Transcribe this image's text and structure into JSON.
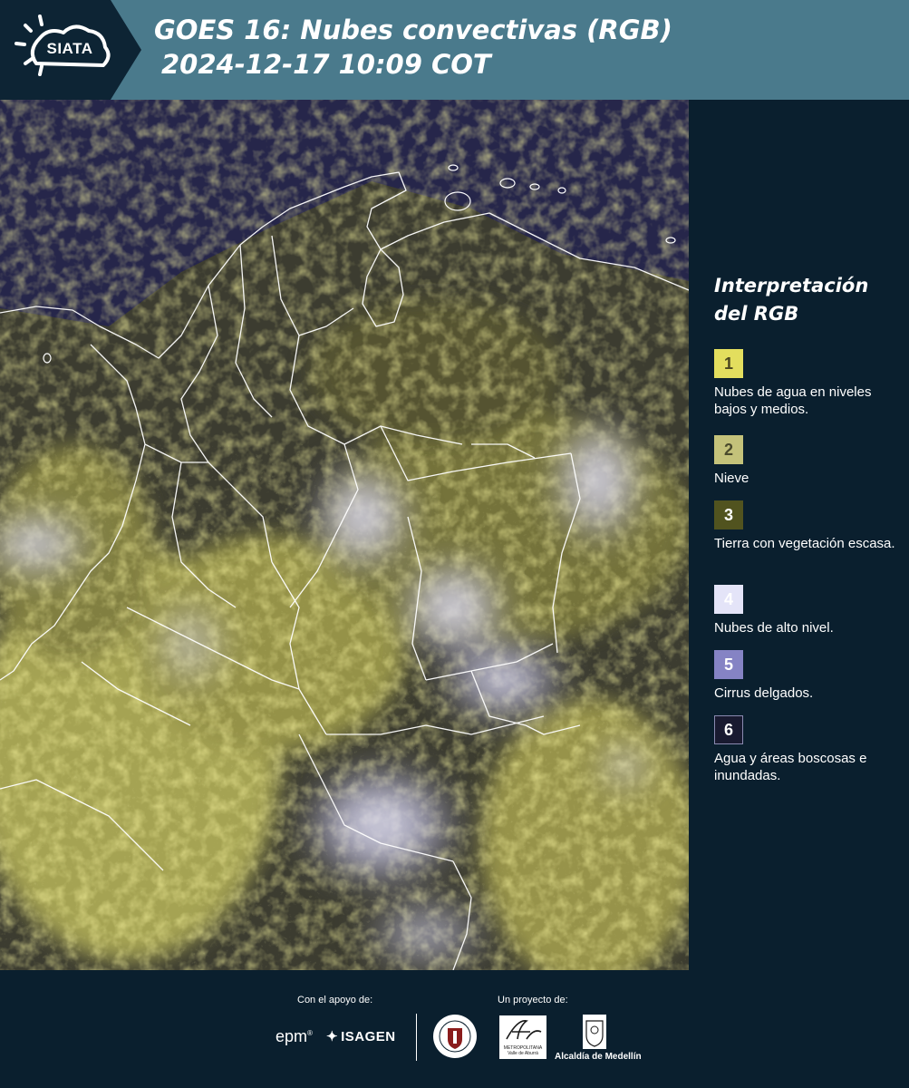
{
  "header": {
    "logo_text": "SIATA",
    "title": "GOES 16: Nubes convectivas (RGB)",
    "subtitle": "2024-12-17 10:09 COT"
  },
  "legend": {
    "title": "Interpretación del RGB",
    "items": [
      {
        "number": "1",
        "label": "Nubes de agua en niveles bajos y medios.",
        "color": "#e3de5e",
        "text_color": "#4a4620"
      },
      {
        "number": "2",
        "label": "Nieve",
        "color": "#c4c27a",
        "text_color": "#4a4a2c"
      },
      {
        "number": "3",
        "label": "Tierra con vegetación escasa.",
        "color": "#51531f",
        "text_color": "#ffffff"
      },
      {
        "number": "4",
        "label": "Nubes de alto nivel.",
        "color": "#e4e4f8",
        "text_color": "#ffffff"
      },
      {
        "number": "5",
        "label": "Cirrus delgados.",
        "color": "#8583c4",
        "text_color": "#ffffff"
      },
      {
        "number": "6",
        "label": "Agua y áreas boscosas e inundadas.",
        "color": "#191a30",
        "text_color": "#ffffff"
      }
    ]
  },
  "footer": {
    "support_label": "Con el apoyo de:",
    "project_label": "Un proyecto de:",
    "sponsors": [
      "epm",
      "ISAGEN"
    ],
    "partners": [
      "Área Metropolitana",
      "Alcaldía de Medellín"
    ],
    "area_caption": "METROPOLITANA Valle de Aburrá",
    "alcaldia_label": "Alcaldía de Medellín"
  },
  "colors": {
    "header_bg": "#4a7a8c",
    "page_bg": "#0a1f2e",
    "logo_bg": "#0d2434"
  }
}
